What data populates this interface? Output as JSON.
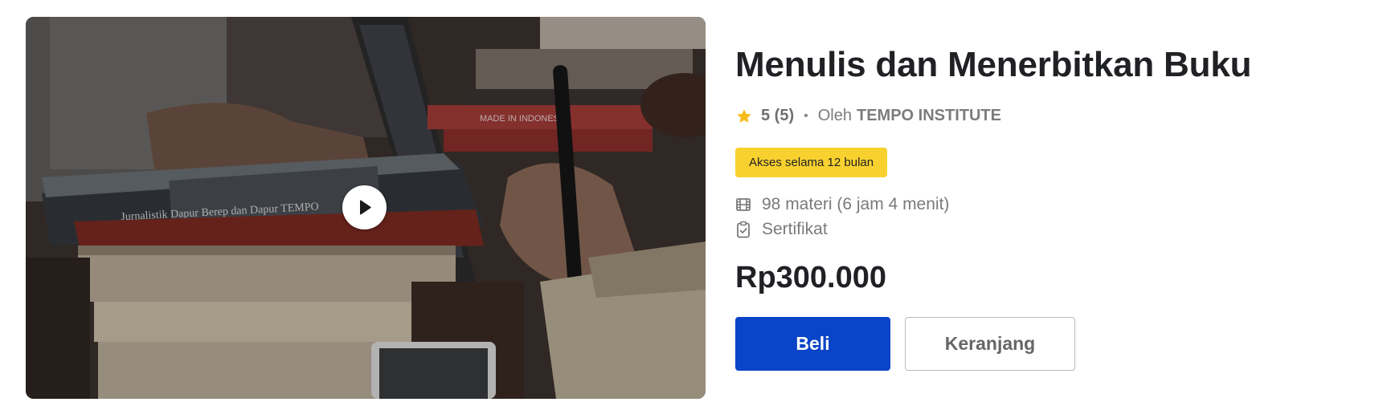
{
  "course": {
    "title": "Menulis dan Menerbitkan Buku",
    "rating": "5 (5)",
    "separator": "•",
    "by_label": "Oleh",
    "author": "TEMPO INSTITUTE",
    "access_badge": "Akses selama 12 bulan",
    "features": [
      {
        "icon": "film-icon",
        "label": "98 materi (6 jam 4 menit)"
      },
      {
        "icon": "clipboard-check-icon",
        "label": "Sertifikat"
      }
    ],
    "price": "Rp300.000"
  },
  "thumbnail": {
    "book_spine_text": "Jurnalistik Dapur Berep dan Dapur TEMPO",
    "book_label_text": "MADE IN INDONESIA"
  },
  "actions": {
    "buy_label": "Beli",
    "cart_label": "Keranjang"
  },
  "colors": {
    "accent": "#0a44c8",
    "badge": "#f8d12f",
    "star": "#f6bc1b"
  }
}
